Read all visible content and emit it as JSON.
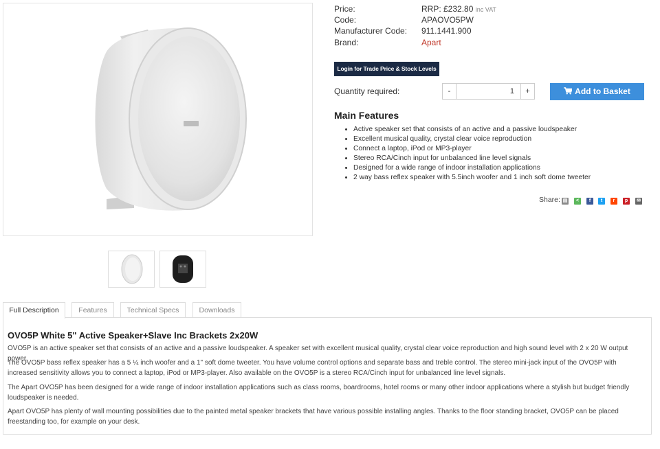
{
  "product": {
    "info": [
      {
        "label": "Price:",
        "value": "RRP: £232.80",
        "suffix": "inc VAT"
      },
      {
        "label": "Code:",
        "value": "APAOVO5PW"
      },
      {
        "label": "Manufacturer Code:",
        "value": "911.1441.900"
      },
      {
        "label": "Brand:",
        "value": "Apart"
      }
    ],
    "login_label": "Login for Trade Price & Stock Levels",
    "quantity_label": "Quantity required:",
    "quantity_value": "1",
    "minus_label": "-",
    "plus_label": "+",
    "basket_label": "Add to Basket",
    "brand_color": "#c0392b",
    "basket_color": "#3d8fdc"
  },
  "features": {
    "title": "Main Features",
    "items": [
      "Active speaker set that consists of an active and a passive loudspeaker",
      "Excellent musical quality, crystal clear voice reproduction",
      "Connect a laptop, iPod or MP3-player",
      "Stereo RCA/Cinch input for unbalanced line level signals",
      "Designed for a wide range of indoor installation applications",
      "2 way bass reflex speaker with 5.5inch woofer and 1 inch soft dome tweeter"
    ]
  },
  "share": {
    "label": "Share:",
    "icons": [
      "print-icon",
      "share-icon",
      "facebook-icon",
      "twitter-icon",
      "reddit-icon",
      "pinterest-icon",
      "email-icon"
    ]
  },
  "tabs": [
    "Full Description",
    "Features",
    "Technical Specs",
    "Downloads"
  ],
  "description": {
    "title": "OVO5P White 5\" Active Speaker+Slave Inc Brackets 2x20W",
    "paragraphs": [
      "OVO5P is an active speaker set that consists of an active and a passive loudspeaker. A speaker set with excellent musical quality, crystal clear voice reproduction and high sound level with 2 x 20 W output power.",
      "The OVO5P bass reflex speaker has a 5 ¼ inch woofer and a 1\" soft dome tweeter. You have volume control options and separate bass and treble control. The stereo mini-jack input of the OVO5P with increased sensitivity allows you to connect a laptop, iPod or MP3-player. Also available on the OVO5P is a stereo RCA/Cinch input for unbalanced line level signals.",
      "The Apart OVO5P has been designed for a wide range of indoor installation applications such as class rooms, boardrooms, hotel rooms or many other indoor applications where a stylish but budget friendly loudspeaker is needed.",
      "Apart OVO5P has plenty of wall mounting possibilities due to the painted metal speaker brackets that have various possible installing angles. Thanks to the floor standing bracket, OVO5P can be placed freestanding too, for example on your desk."
    ]
  }
}
